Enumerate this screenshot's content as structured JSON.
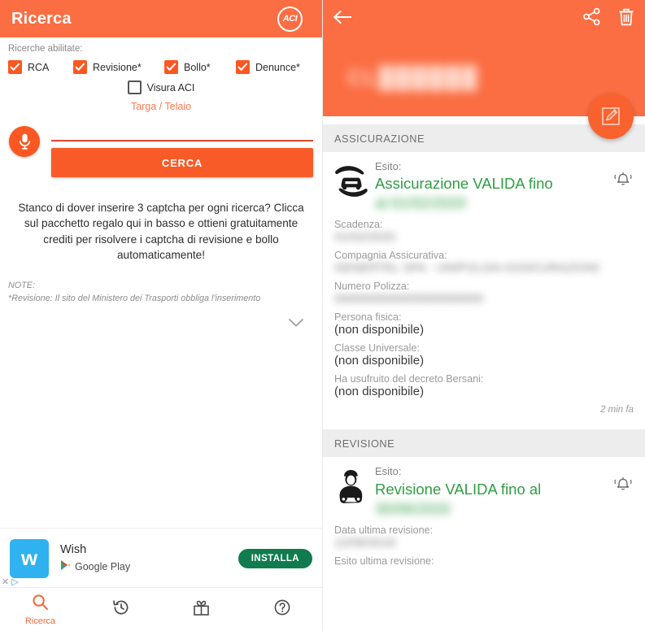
{
  "left": {
    "appbar": {
      "title": "Ricerca",
      "logo_text": "ACI",
      "logo_icon": "aci-circle-logo"
    },
    "filters": {
      "label": "Ricerche abilitate:",
      "row1": [
        {
          "label": "RCA",
          "checked": true
        },
        {
          "label": "Revisione*",
          "checked": true
        },
        {
          "label": "Bollo*",
          "checked": true
        },
        {
          "label": "Denunce*",
          "checked": true
        }
      ],
      "row2": [
        {
          "label": "Visura ACI",
          "checked": false
        }
      ]
    },
    "targa_link": "Targa / Telaio",
    "search": {
      "mic_icon": "microphone-icon",
      "input_value": "",
      "input_placeholder": "",
      "button_label": "CERCA"
    },
    "promo": "Stanco di dover inserire 3 captcha per ogni ricerca? Clicca sul pacchetto regalo qui in basso e ottieni gratuitamente crediti per risolvere i captcha di revisione e bollo automaticamente!",
    "note": {
      "title": "NOTE:",
      "line1": "*Revisione: Il sito del Ministero dei Trasporti obbliga l'inserimento"
    },
    "expand_icon": "chevron-down-icon",
    "ad": {
      "icon_letter": "w",
      "title": "Wish",
      "store": "Google Play",
      "install_label": "INSTALLA",
      "close_label": "✕",
      "adchoices_label": "▷"
    },
    "nav": [
      {
        "icon": "search-icon",
        "label": "Ricerca",
        "active": true
      },
      {
        "icon": "history-icon",
        "label": "",
        "active": false
      },
      {
        "icon": "gift-icon",
        "label": "",
        "active": false
      },
      {
        "icon": "help-icon",
        "label": "",
        "active": false
      }
    ]
  },
  "right": {
    "header": {
      "back_icon": "arrow-left-icon",
      "share_icon": "share-icon",
      "delete_icon": "trash-icon",
      "plate_redacted": "CL██████",
      "fab_icon": "edit-square-icon"
    },
    "sections": [
      {
        "title": "ASSICURAZIONE",
        "icon": "car-insurance-hands-icon",
        "bell_icon": "bell-ring-icon",
        "esito_label": "Esito:",
        "esito_value": "Assicurazione VALIDA fino",
        "esito_value_redacted": "al 01/02/2020",
        "fields": [
          {
            "label": "Scadenza:",
            "value": "01/02/2020",
            "redacted": true
          },
          {
            "label": "Compagnia Assicurativa:",
            "value": "GENERTEL SPA - UNIPOLSAI ASSICURAZIONI",
            "redacted": true
          },
          {
            "label": "Numero Polizza:",
            "value": "0000000000000000000000",
            "redacted": true
          },
          {
            "label": "Persona fisica:",
            "value": "(non disponibile)",
            "redacted": false
          },
          {
            "label": "Classe Universale:",
            "value": "(non disponibile)",
            "redacted": false
          },
          {
            "label": "Ha usufruito del decreto Bersani:",
            "value": "(non disponibile)",
            "redacted": false
          }
        ],
        "time_ago": "2 min fa"
      },
      {
        "title": "REVISIONE",
        "icon": "mechanic-wrench-icon",
        "bell_icon": "bell-ring-icon",
        "esito_label": "Esito:",
        "esito_value": "Revisione VALIDA fino al",
        "esito_value_redacted": "30/06/2020",
        "fields": [
          {
            "label": "Data ultima revisione:",
            "value": "12/06/2018",
            "redacted": true
          },
          {
            "label": "Esito ultima revisione:",
            "value": "",
            "redacted": false
          }
        ],
        "time_ago": ""
      }
    ]
  },
  "colors": {
    "brand_orange": "#fb6d42",
    "accent_orange": "#f95b28",
    "valid_green": "#2f9e44",
    "install_green": "#0f7b4f",
    "section_gray": "#ededed"
  }
}
